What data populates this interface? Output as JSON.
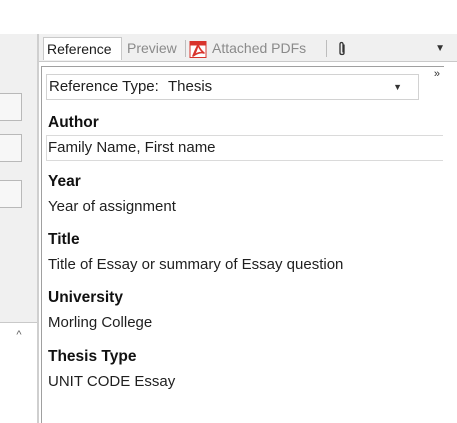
{
  "tabs": {
    "reference": "Reference",
    "preview": "Preview",
    "attached_pdfs": "Attached PDFs",
    "clip_icon": "paperclip-icon",
    "menu_icon": "chevron-down-icon",
    "pdf_icon": "pdf-icon"
  },
  "panel": {
    "more_icon": "double-chevron-right-icon",
    "reference_type": {
      "label": "Reference Type:",
      "value": "Thesis"
    },
    "fields": [
      {
        "label": "Author",
        "value": "Family Name, First name"
      },
      {
        "label": "Year",
        "value": "Year of assignment"
      },
      {
        "label": "Title",
        "value": "Title of Essay or summary of Essay question"
      },
      {
        "label": "University",
        "value": "Morling College"
      },
      {
        "label": "Thesis Type",
        "value": "UNIT CODE Essay"
      }
    ]
  },
  "colors": {
    "pdf_red": "#d8332c",
    "tab_bg": "#f0f0f0",
    "border": "#a0a0a0"
  }
}
